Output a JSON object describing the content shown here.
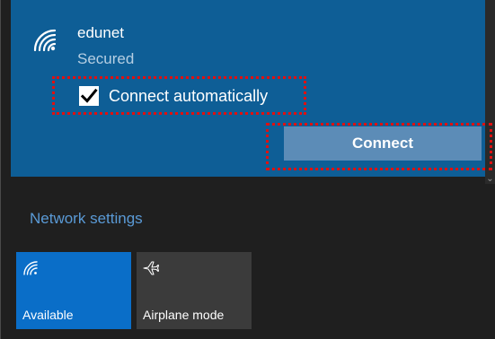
{
  "network": {
    "name": "edunet",
    "status": "Secured",
    "connect_automatically_label": "Connect automatically",
    "connect_automatically_checked": true,
    "connect_button_label": "Connect"
  },
  "network_settings_label": "Network settings",
  "quick_actions": [
    {
      "label": "Available",
      "icon": "wifi-icon",
      "active": true
    },
    {
      "label": "Airplane mode",
      "icon": "airplane-icon",
      "active": false
    }
  ],
  "colors": {
    "panel_background": "#1f1f1f",
    "selected_network_background": "#0e5e96",
    "connect_button": "#5c8cb7",
    "accent": "#0a6ec8",
    "annotation_outline": "#e01010"
  }
}
